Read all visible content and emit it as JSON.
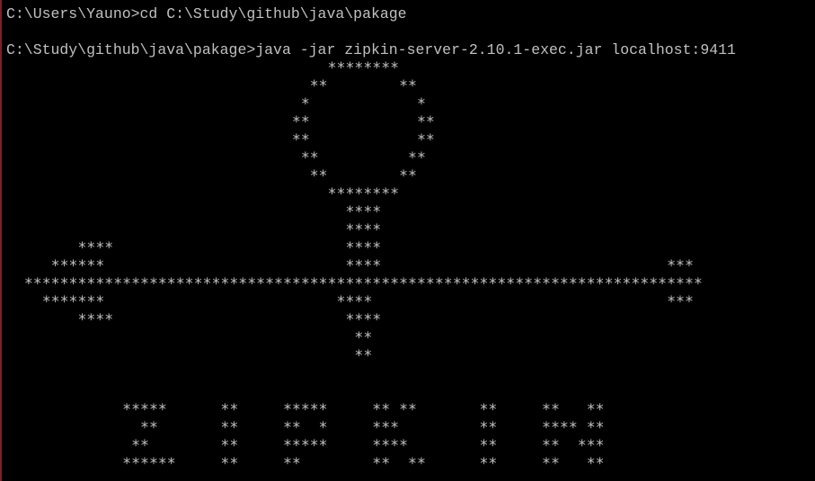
{
  "console": {
    "prompt_line_1": "C:\\Users\\Yauno>cd C:\\Study\\github\\java\\pakage",
    "prompt_line_2": "C:\\Study\\github\\java\\pakage>java -jar zipkin-server-2.10.1-exec.jar localhost:9411",
    "banner": [
      "                                    ********",
      "                                  **        **",
      "                                 *            *",
      "                                **            **",
      "                                **            **",
      "                                 **          **",
      "                                  **        **",
      "                                    ********",
      "                                      ****",
      "                                      ****",
      "        ****                          ****",
      "     ******                           ****                                ***",
      "  ****************************************************************************",
      "    *******                          ****                                 ***",
      "        ****                          ****",
      "                                       **",
      "                                       **",
      "",
      "",
      "             *****      **     *****     ** **       **     **   **",
      "               **       **     **  *     ***         **     **** **",
      "              **        **     *****     ****        **     **  ***",
      "             ******     **     **        **  **      **     **   **"
    ],
    "colors": {
      "background": "#000000",
      "text": "#c0c0c0",
      "left_border": "#7a2222"
    }
  }
}
